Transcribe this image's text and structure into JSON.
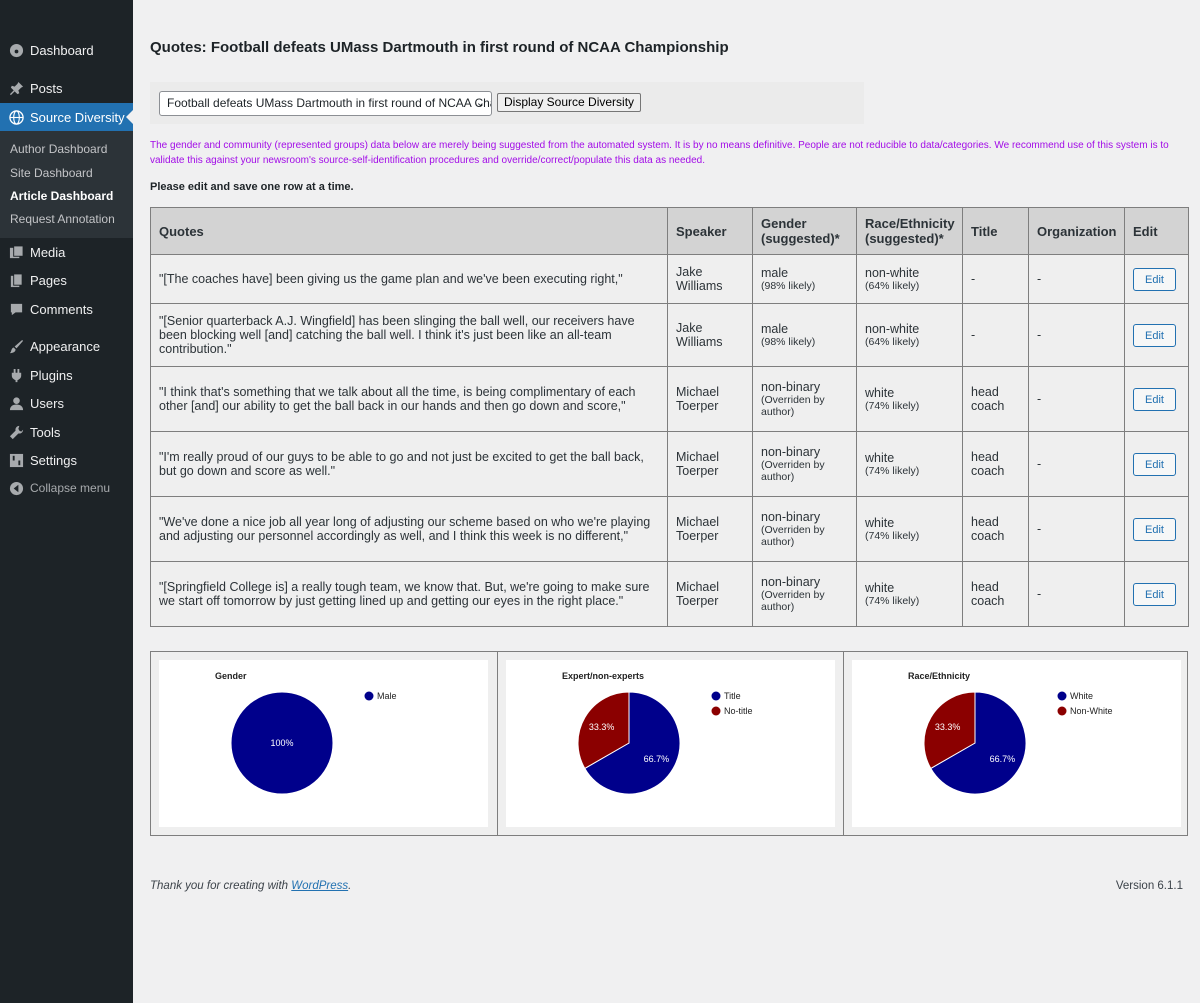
{
  "sidebar": {
    "dashboard": "Dashboard",
    "posts": "Posts",
    "source_diversity": "Source Diversity",
    "submenu": [
      "Author Dashboard",
      "Site Dashboard",
      "Article Dashboard",
      "Request Annotation"
    ],
    "media": "Media",
    "pages": "Pages",
    "comments": "Comments",
    "appearance": "Appearance",
    "plugins": "Plugins",
    "users": "Users",
    "tools": "Tools",
    "settings": "Settings",
    "collapse": "Collapse menu"
  },
  "page": {
    "title": "Quotes: Football defeats UMass Dartmouth in first round of NCAA Championship",
    "selected_article": "Football defeats UMass Dartmouth in first round of NCAA Championship",
    "display_button": "Display Source Diversity",
    "notice": "The gender and community (represented groups) data below are merely being suggested from the automated system. It is by no means definitive. People are not reducible to data/categories. We recommend use of this system is to validate this against your newsroom's source-self-identification procedures and override/correct/populate this data as needed.",
    "edit_note": "Please edit and save one row at a time."
  },
  "table": {
    "headers": [
      "Quotes",
      "Speaker",
      "Gender (suggested)*",
      "Race/Ethnicity (suggested)*",
      "Title",
      "Organization",
      "Edit"
    ],
    "rows": [
      {
        "quote": "\"[The coaches have] been giving us the game plan and we've been executing right,\"",
        "speaker": "Jake Williams",
        "gender": "male",
        "gender_note": "(98% likely)",
        "race": "non-white",
        "race_note": "(64% likely)",
        "title": "-",
        "org": "-",
        "edit": "Edit"
      },
      {
        "quote": "\"[Senior quarterback A.J. Wingfield] has been slinging the ball well, our receivers have been blocking well [and] catching the ball well. I think it's just been like an all-team contribution.\"",
        "speaker": "Jake Williams",
        "gender": "male",
        "gender_note": "(98% likely)",
        "race": "non-white",
        "race_note": "(64% likely)",
        "title": "-",
        "org": "-",
        "edit": "Edit"
      },
      {
        "quote": "\"I think that's something that we talk about all the time, is being complimentary of each other [and] our ability to get the ball back in our hands and then go down and score,\"",
        "speaker": "Michael Toerper",
        "gender": "non-binary",
        "gender_note": "(Overriden by author)",
        "race": "white",
        "race_note": "(74% likely)",
        "title": "head coach",
        "org": "-",
        "edit": "Edit"
      },
      {
        "quote": "\"I'm really proud of our guys to be able to go and not just be excited to get the ball back, but go down and score as well.\"",
        "speaker": "Michael Toerper",
        "gender": "non-binary",
        "gender_note": "(Overriden by author)",
        "race": "white",
        "race_note": "(74% likely)",
        "title": "head coach",
        "org": "-",
        "edit": "Edit"
      },
      {
        "quote": "\"We've done a nice job all year long of adjusting our scheme based on who we're playing and adjusting our personnel accordingly as well, and I think this week is no different,\"",
        "speaker": "Michael Toerper",
        "gender": "non-binary",
        "gender_note": "(Overriden by author)",
        "race": "white",
        "race_note": "(74% likely)",
        "title": "head coach",
        "org": "-",
        "edit": "Edit"
      },
      {
        "quote": "\"[Springfield College is] a really tough team, we know that. But, we're going to make sure we start off tomorrow by just getting lined up and getting our eyes in the right place.\"",
        "speaker": "Michael Toerper",
        "gender": "non-binary",
        "gender_note": "(Overriden by author)",
        "race": "white",
        "race_note": "(74% likely)",
        "title": "head coach",
        "org": "-",
        "edit": "Edit"
      }
    ]
  },
  "chart_data": [
    {
      "type": "pie",
      "title": "Gender",
      "categories": [
        "Male"
      ],
      "values": [
        100
      ],
      "labels": [
        "100%"
      ],
      "colors": [
        "#00008b"
      ],
      "legend": "top-right"
    },
    {
      "type": "pie",
      "title": "Expert/non-experts",
      "categories": [
        "Title",
        "No-title"
      ],
      "values": [
        66.7,
        33.3
      ],
      "labels": [
        "66.7%",
        "33.3%"
      ],
      "colors": [
        "#00008b",
        "#8b0000"
      ],
      "legend": "top-right"
    },
    {
      "type": "pie",
      "title": "Race/Ethnicity",
      "categories": [
        "White",
        "Non-White"
      ],
      "values": [
        66.7,
        33.3
      ],
      "labels": [
        "66.7%",
        "33.3%"
      ],
      "colors": [
        "#00008b",
        "#8b0000"
      ],
      "legend": "top-right"
    }
  ],
  "footer": {
    "thanks_prefix": "Thank you for creating with ",
    "wordpress_link": "WordPress",
    "thanks_suffix": ".",
    "version": "Version 6.1.1"
  }
}
